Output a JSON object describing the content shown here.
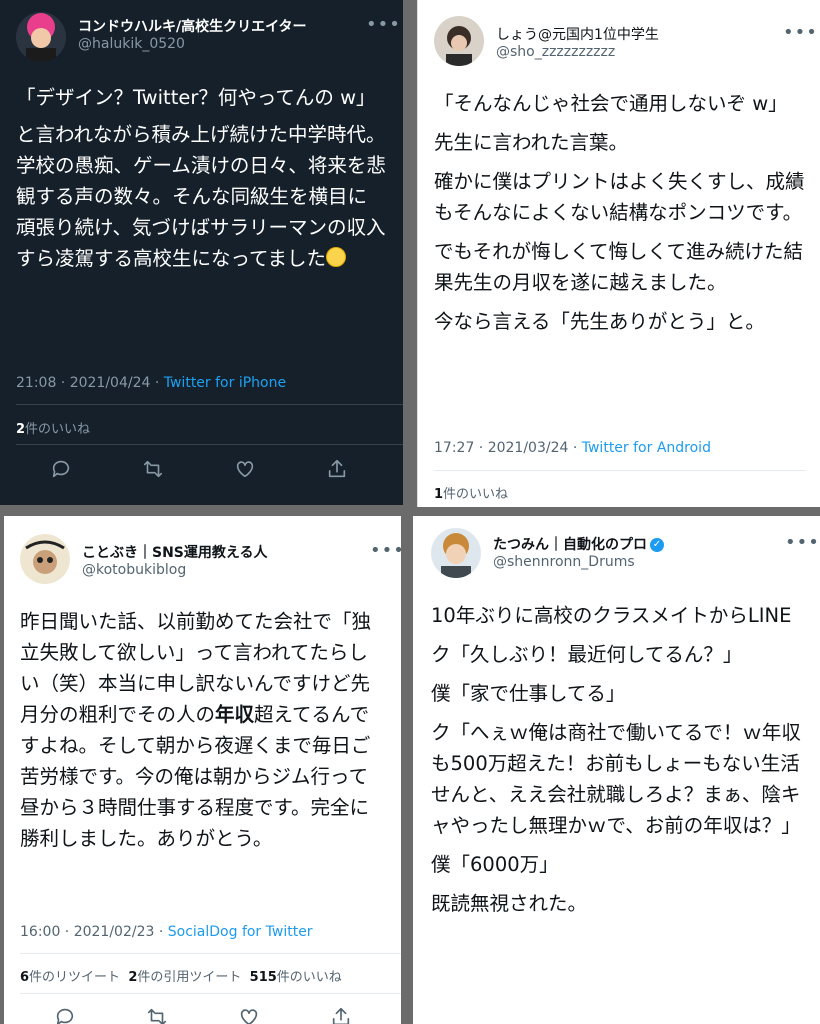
{
  "tweets": [
    {
      "name": "コンドウハルキ/高校生クリエイター",
      "handle": "@halukik_0520",
      "more_icon": "more-dots-icon",
      "lines": [
        "「デザイン？Twitter？何やってんの w」",
        "と言われながら積み上げ続けた中学時代。学校の愚痴、ゲーム漬けの日々、将来を悲観する声の数々。そんな同級生を横目に頑張り続け、気づけばサラリーマンの収入すら凌駕する高校生になってました"
      ],
      "emoji": "smiling-face-icon",
      "time": "21:08 · 2021/04/24 · ",
      "source": "Twitter for iPhone",
      "likes_count": "2",
      "likes_label": "件のいいね"
    },
    {
      "name": "しょう@元国内1位中学生",
      "handle": "@sho_zzzzzzzzzz",
      "lines": [
        "「そんなんじゃ社会で通用しないぞ w」",
        "先生に言われた言葉。",
        "確かに僕はプリントはよく失くすし、成績もそんなによくない結構なポンコツです。",
        "でもそれが悔しくて悔しくて進み続けた結果先生の月収を遂に越えました。",
        "今なら言える「先生ありがとう」と。"
      ],
      "time": "17:27 · 2021/03/24 · ",
      "source": "Twitter for Android",
      "likes_count": "1",
      "likes_label": "件のいいね"
    },
    {
      "name": "ことぶき｜SNS運用教える人",
      "handle": "@kotobukiblog",
      "text_before": "昨日聞いた話、以前勤めてた会社で「独立失敗して欲しい」って言われてたらしい（笑）本当に申し訳ないんですけど先月分の粗利でその人の",
      "text_bold": "年収",
      "text_after": "超えてるんですよね。そして朝から夜遅くまで毎日ご苦労様です。今の俺は朝からジム行って昼から３時間仕事する程度です。完全に勝利しました。ありがとう。",
      "time": "16:00 · 2021/02/23 · ",
      "source": "SocialDog for Twitter",
      "retweets_count": "6",
      "retweets_label": "件のリツイート",
      "quotes_count": "2",
      "quotes_label": "件の引用ツイート",
      "likes_count": "515",
      "likes_label": "件のいいね"
    },
    {
      "name": "たつみん｜自動化のプロ",
      "verified_mark": "✓",
      "handle": "@shennronn_Drums",
      "lines": [
        "10年ぶりに高校のクラスメイトからLINE",
        "ク「久しぶり！最近何してるん？」",
        "僕「家で仕事してる」",
        "ク「へぇｗ俺は商社で働いてるで！ｗ年収も500万超えた！お前もしょーもない生活せんと、ええ会社就職しろよ？まぁ、陰キャやったし無理かｗで、お前の年収は？」",
        "僕「6000万」",
        "既読無視された。"
      ]
    }
  ],
  "colors": {
    "dark_bg": "#15202b",
    "link_blue": "#1d9bf0"
  },
  "icons": [
    "reply-icon",
    "retweet-icon",
    "like-heart-icon",
    "share-icon",
    "more-dots-icon",
    "verified-badge-icon"
  ]
}
